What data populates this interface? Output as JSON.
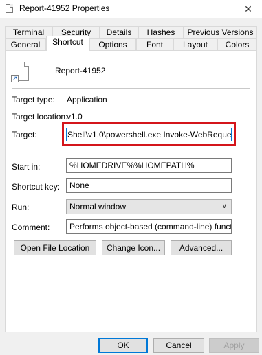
{
  "window": {
    "title": "Report-41952 Properties",
    "close_glyph": "✕"
  },
  "tabs_row1": [
    "Terminal",
    "Security",
    "Details",
    "Hashes",
    "Previous Versions"
  ],
  "tabs_row2": [
    "General",
    "Shortcut",
    "Options",
    "Font",
    "Layout",
    "Colors"
  ],
  "active_tab": "Shortcut",
  "shortcut": {
    "name": "Report-41952",
    "target_type_label": "Target type:",
    "target_type_value": "Application",
    "target_location_label": "Target location:",
    "target_location_value": "v1.0",
    "target_label": "Target:",
    "target_value": "Shell\\v1.0\\powershell.exe Invoke-WebRequest \"",
    "start_in_label": "Start in:",
    "start_in_value": "%HOMEDRIVE%%HOMEPATH%",
    "shortcut_key_label": "Shortcut key:",
    "shortcut_key_value": "None",
    "run_label": "Run:",
    "run_value": "Normal window",
    "comment_label": "Comment:",
    "comment_value": "Performs object-based (command-line) functions"
  },
  "actions": {
    "open_file_location": "Open File Location",
    "change_icon": "Change Icon...",
    "advanced": "Advanced..."
  },
  "footer": {
    "ok": "OK",
    "cancel": "Cancel",
    "apply": "Apply"
  },
  "colors": {
    "highlight_border": "#d4151b",
    "focus_blue": "#0078d7"
  }
}
